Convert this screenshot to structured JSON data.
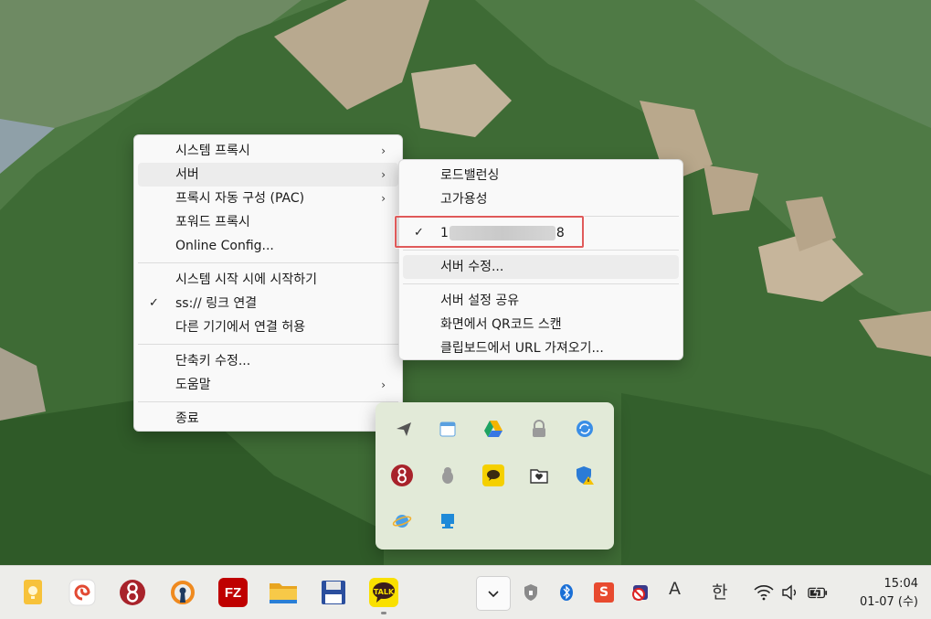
{
  "main_menu": {
    "items": [
      {
        "label": "시스템 프록시",
        "submenu": true
      },
      {
        "label": "서버",
        "submenu": true
      },
      {
        "label": "프록시 자동 구성 (PAC)",
        "submenu": true
      },
      {
        "label": "포워드 프록시"
      },
      {
        "label": "Online Config..."
      },
      {
        "label": "시스템 시작 시에 시작하기"
      },
      {
        "label": "ss:// 링크 연결",
        "checked": true
      },
      {
        "label": "다른 기기에서 연결 허용"
      },
      {
        "label": "단축키 수정..."
      },
      {
        "label": "도움말",
        "submenu": true
      },
      {
        "label": "종료"
      }
    ]
  },
  "server_menu": {
    "load_balancing": "로드밸런싱",
    "high_availability": "고가용성",
    "server_prefix": "1",
    "server_suffix": "8",
    "edit_servers": "서버 수정...",
    "share_config": "서버 설정 공유",
    "scan_qr": "화면에서 QR코드 스캔",
    "import_clipboard": "클립보드에서 URL 가져오기..."
  },
  "tray_flyout": {
    "icons": [
      "send-icon",
      "calendar-icon",
      "google-drive-icon",
      "lock-icon",
      "sync-icon",
      "shadowsocks-icon",
      "penguin-icon",
      "chat-bubble-icon",
      "folder-heart-icon",
      "shield-warning-icon",
      "globe-icon",
      "monitor-icon"
    ]
  },
  "taskbar": {
    "apps": [
      "sticky-note-icon",
      "swirl-app-icon",
      "shadowsocks-app-icon",
      "openvpn-icon",
      "filezilla-icon",
      "file-explorer-icon",
      "save-disk-icon",
      "kakaotalk-icon"
    ],
    "filezilla_label": "FZ",
    "kakao_label": "TALK",
    "ime_mode_a": "A",
    "ime_mode_han": "한",
    "time": "15:04",
    "date": "01-07 (수)"
  },
  "colors": {
    "highlight_box": "#e05a5a",
    "menu_bg": "#f9f9f9",
    "flyout_bg": "#e2ead8",
    "taskbar_bg": "#ededea"
  }
}
